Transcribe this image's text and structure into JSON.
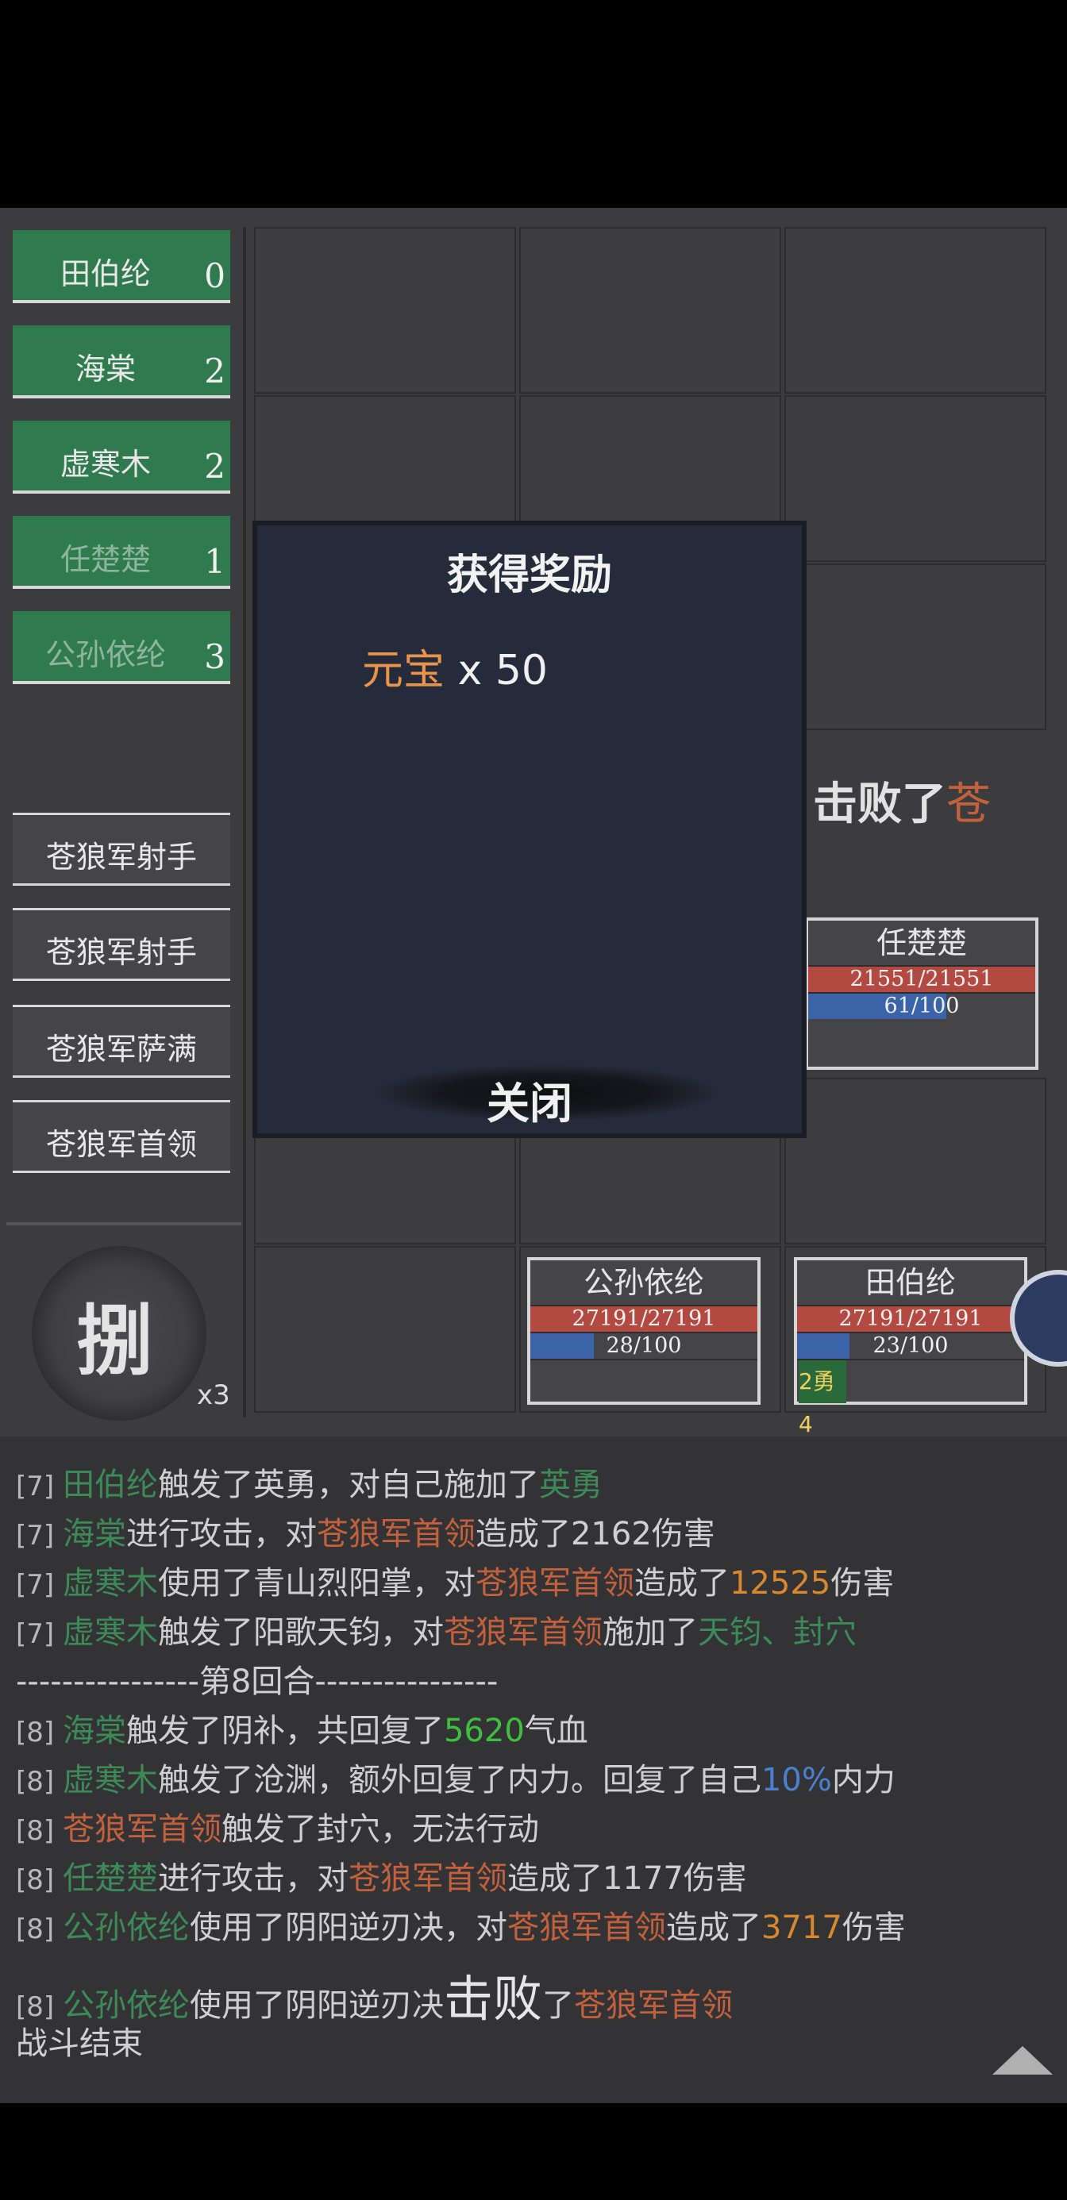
{
  "team": [
    {
      "name": "田伯纶",
      "count": "0",
      "dim": false
    },
    {
      "name": "海棠",
      "count": "2",
      "dim": false
    },
    {
      "name": "虚寒木",
      "count": "2",
      "dim": false
    },
    {
      "name": "任楚楚",
      "count": "1",
      "dim": true
    },
    {
      "name": "公孙依纶",
      "count": "3",
      "dim": true
    }
  ],
  "enemies": [
    "苍狼军射手",
    "苍狼军射手",
    "苍狼军萨满",
    "苍狼军首领"
  ],
  "skill": {
    "char": "捌",
    "multiplier": "x3"
  },
  "banner": {
    "prefix": "击败了",
    "target": "苍"
  },
  "heroes": [
    {
      "name": "任楚楚",
      "hp": "21551/21551",
      "hp_frac": 1.0,
      "mp": "61/100",
      "mp_frac": 0.61
    },
    {
      "name": "公孙依纶",
      "hp": "27191/27191",
      "hp_frac": 1.0,
      "mp": "28/100",
      "mp_frac": 0.28
    },
    {
      "name": "田伯纶",
      "hp": "27191/27191",
      "hp_frac": 1.0,
      "mp": "23/100",
      "mp_frac": 0.23,
      "buff": "2勇4"
    }
  ],
  "modal": {
    "title": "获得奖励",
    "reward_name": "元宝",
    "reward_qty": " x 50",
    "close": "关闭"
  },
  "log": [
    {
      "idx": "[7] ",
      "parts": [
        [
          "green",
          "田伯纶"
        ],
        [
          "",
          "触发了英勇，对自己施加了"
        ],
        [
          "green",
          "英勇"
        ]
      ]
    },
    {
      "idx": "[7] ",
      "parts": [
        [
          "green",
          "海棠"
        ],
        [
          "",
          "进行攻击，对"
        ],
        [
          "red",
          "苍狼军首领"
        ],
        [
          "",
          "造成了2162伤害"
        ]
      ]
    },
    {
      "idx": "[7] ",
      "parts": [
        [
          "green",
          "虚寒木"
        ],
        [
          "",
          "使用了青山烈阳掌，对"
        ],
        [
          "red",
          "苍狼军首领"
        ],
        [
          "",
          "造成了"
        ],
        [
          "orange",
          "12525"
        ],
        [
          "",
          "伤害"
        ]
      ]
    },
    {
      "idx": "[7] ",
      "parts": [
        [
          "green",
          "虚寒木"
        ],
        [
          "",
          "触发了阳歌天钧，对"
        ],
        [
          "red",
          "苍狼军首领"
        ],
        [
          "",
          "施加了"
        ],
        [
          "green",
          "天钧、封穴"
        ]
      ]
    },
    {
      "divider": "----------------第8回合----------------"
    },
    {
      "idx": "[8] ",
      "parts": [
        [
          "green",
          "海棠"
        ],
        [
          "",
          "触发了阴补，共回复了"
        ],
        [
          "bright",
          "5620"
        ],
        [
          "",
          "气血"
        ]
      ]
    },
    {
      "idx": "[8] ",
      "parts": [
        [
          "green",
          "虚寒木"
        ],
        [
          "",
          "触发了沧渊，额外回复了内力。回复了自己"
        ],
        [
          "blue",
          "10%"
        ],
        [
          "",
          "内力"
        ]
      ]
    },
    {
      "idx": "[8] ",
      "parts": [
        [
          "red",
          "苍狼军首领"
        ],
        [
          "",
          "触发了封穴，无法行动"
        ]
      ]
    },
    {
      "idx": "[8] ",
      "parts": [
        [
          "green",
          "任楚楚"
        ],
        [
          "",
          "进行攻击，对"
        ],
        [
          "red",
          "苍狼军首领"
        ],
        [
          "",
          "造成了1177伤害"
        ]
      ]
    },
    {
      "idx": "[8] ",
      "parts": [
        [
          "green",
          "公孙依纶"
        ],
        [
          "",
          "使用了阴阳逆刃决，对"
        ],
        [
          "red",
          "苍狼军首领"
        ],
        [
          "",
          "造成了"
        ],
        [
          "orange",
          "3717"
        ],
        [
          "",
          "伤害"
        ]
      ]
    },
    {
      "idx": "[8] ",
      "parts": [
        [
          "green",
          "公孙依纶"
        ],
        [
          "",
          "使用了阴阳逆刃决"
        ],
        [
          "big",
          "击败"
        ],
        [
          "",
          "了"
        ],
        [
          "red",
          "苍狼军首领"
        ]
      ]
    },
    {
      "plain": "战斗结束"
    }
  ],
  "colors": {
    "team_green": "#2f7a4e",
    "modal_bg": "#252b3b",
    "hp": "#b34a42",
    "mp": "#3b63a8",
    "reward": "#e8944a"
  }
}
